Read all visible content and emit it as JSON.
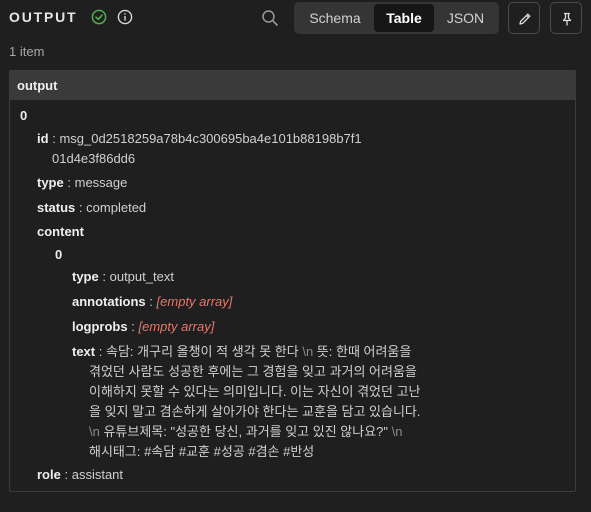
{
  "header": {
    "title": "OUTPUT",
    "tabs": [
      {
        "label": "Schema",
        "active": false
      },
      {
        "label": "Table",
        "active": true
      },
      {
        "label": "JSON",
        "active": false
      }
    ],
    "status_color": "#4caf50"
  },
  "item_count": "1 item",
  "panel": {
    "header": "output",
    "index0": "0",
    "id_key": "id",
    "id_line1": "msg_0d2518259a78b4c300695ba4e101b88198b7f1",
    "id_line2": "01d4e3f86dd6",
    "type_key": "type",
    "type_value": "message",
    "status_key": "status",
    "status_value": "completed",
    "content_key": "content",
    "content_index": "0",
    "c_type_key": "type",
    "c_type_value": "output_text",
    "annotations_key": "annotations",
    "annotations_value": "[empty array]",
    "logprobs_key": "logprobs",
    "logprobs_value": "[empty array]",
    "text_key": "text",
    "text_lines": {
      "l1a": "속담: 개구리 올챙이 적 생각 못 한다 ",
      "l1nl": "\\n",
      "l1b": " 뜻: 한때 어려움을",
      "l2": "겪었던 사람도 성공한 후에는 그 경험을 잊고 과거의 어려움을",
      "l3": "이해하지 못할 수 있다는 의미입니다. 이는 자신이 겪었던 고난",
      "l4": "을 잊지 말고 겸손하게 살아가야 한다는 교훈을 담고 있습니다.",
      "l5nl": "\\n",
      "l5a": " 유튜브제목: \"성공한 당신, 과거를 잊고 있진 않나요?\" ",
      "l5nl2": "\\n",
      "l6": "해시태그: #속담 #교훈 #성공 #겸손 #반성"
    },
    "role_key": "role",
    "role_value": "assistant",
    "separator": ":"
  }
}
